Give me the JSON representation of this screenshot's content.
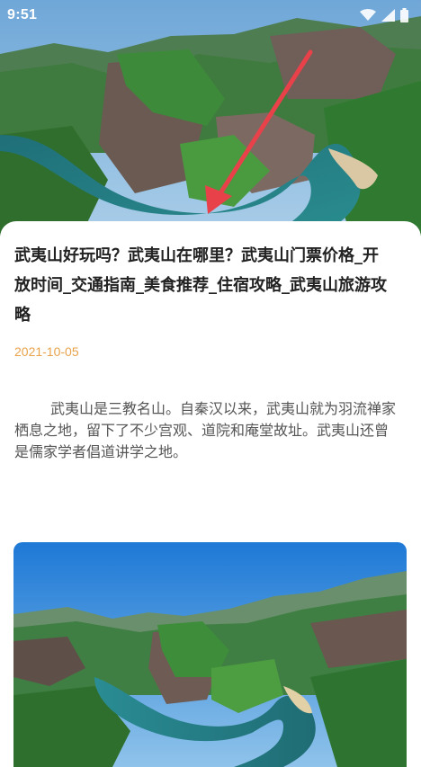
{
  "status_bar": {
    "time": "9:51",
    "icons": [
      "wifi-icon",
      "signal-icon",
      "battery-icon"
    ]
  },
  "hero_image": {
    "subject": "aerial view of river winding through green mountains",
    "annotation": "red-arrow-icon"
  },
  "article": {
    "title": "武夷山好玩吗？武夷山在哪里？武夷山门票价格_开放时间_交通指南_美食推荐_住宿攻略_武夷山旅游攻略",
    "date": "2021-10-05",
    "body": "武夷山是三教名山。自秦汉以来，武夷山就为羽流禅家栖息之地，留下了不少宫观、道院和庵堂故址。武夷山还曾是儒家学者倡道讲学之地。"
  },
  "content_image": {
    "subject": "river valley with green hills and cliffs under blue sky"
  },
  "colors": {
    "date": "#e8a34a",
    "title": "#222222",
    "body": "#555555",
    "arrow": "#e8414a"
  }
}
